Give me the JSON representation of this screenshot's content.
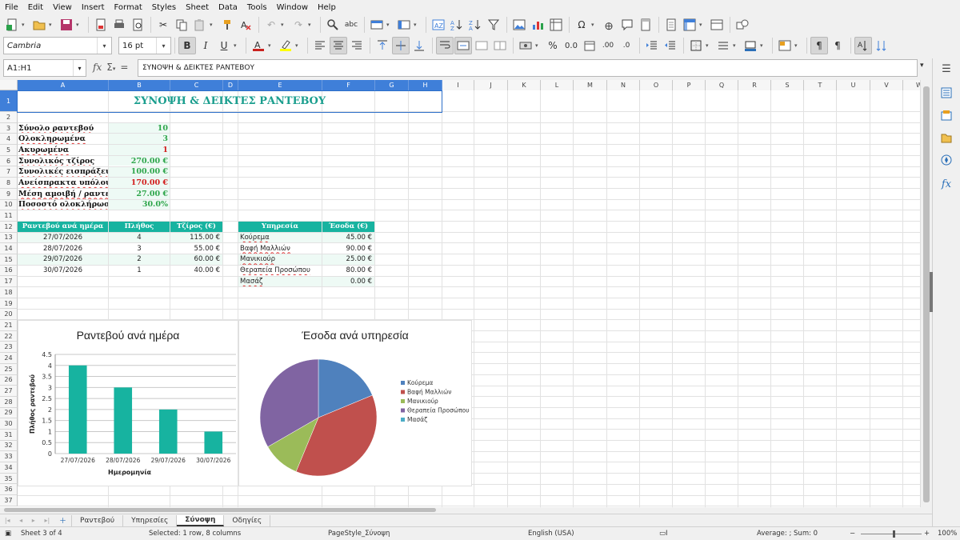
{
  "menu": [
    "File",
    "Edit",
    "View",
    "Insert",
    "Format",
    "Styles",
    "Sheet",
    "Data",
    "Tools",
    "Window",
    "Help"
  ],
  "toolbar2": {
    "font_name": "Cambria",
    "font_size": "16 pt"
  },
  "formula": {
    "name_box": "A1:H1",
    "content": "ΣΥΝΟΨΗ & ΔΕΙΚΤΕΣ ΡΑΝΤΕΒΟΥ"
  },
  "columns": [
    "A",
    "B",
    "C",
    "D",
    "E",
    "F",
    "G",
    "H",
    "I",
    "J",
    "K",
    "L",
    "M",
    "N",
    "O",
    "P",
    "Q",
    "R",
    "S",
    "T",
    "U",
    "V",
    "W"
  ],
  "rows": [
    "1",
    "2",
    "3",
    "4",
    "5",
    "6",
    "7",
    "8",
    "9",
    "10",
    "11",
    "12",
    "13",
    "14",
    "15",
    "16",
    "17",
    "18",
    "19",
    "20",
    "21",
    "22",
    "23",
    "24",
    "25",
    "26",
    "27",
    "28",
    "29",
    "30",
    "31",
    "32",
    "33",
    "34",
    "35",
    "36",
    "37"
  ],
  "sheet": {
    "title": "ΣΥΝΟΨΗ & ΔΕΙΚΤΕΣ ΡΑΝΤΕΒΟΥ",
    "kpis": [
      {
        "label": "Σύνολο ραντεβού",
        "value": "10",
        "color": "g"
      },
      {
        "label": "Ολοκληρωμένα",
        "value": "3",
        "color": "g"
      },
      {
        "label": "Ακυρωμένα",
        "value": "1",
        "color": "r"
      },
      {
        "label": "Συνολικός τζίρος",
        "value": "270.00 €",
        "color": "g"
      },
      {
        "label": "Συνολικές εισπράξεις",
        "value": "100.00 €",
        "color": "g"
      },
      {
        "label": "Ανείσπρακτα υπόλοιπα",
        "value": "170.00 €",
        "color": "r"
      },
      {
        "label": "Μέση αμοιβή / ραντεβού",
        "value": "27.00 €",
        "color": "g"
      },
      {
        "label": "Ποσοστό ολοκλήρωσης",
        "value": "30.0%",
        "color": "g"
      }
    ],
    "table1": {
      "headers": [
        "Ραντεβού ανά ημέρα",
        "Πλήθος",
        "Τζίρος (€)"
      ],
      "rows": [
        [
          "27/07/2026",
          "4",
          "115.00 €"
        ],
        [
          "28/07/2026",
          "3",
          "55.00 €"
        ],
        [
          "29/07/2026",
          "2",
          "60.00 €"
        ],
        [
          "30/07/2026",
          "1",
          "40.00 €"
        ]
      ]
    },
    "table2": {
      "headers": [
        "Υπηρεσία",
        "Έσοδα (€)"
      ],
      "rows": [
        [
          "Κούρεμα",
          "45.00 €"
        ],
        [
          "Βαφή Μαλλιών",
          "90.00 €"
        ],
        [
          "Μανικιούρ",
          "25.00 €"
        ],
        [
          "Θεραπεία Προσώπου",
          "80.00 €"
        ],
        [
          "Μασάζ",
          "0.00 €"
        ]
      ]
    }
  },
  "chart_data": [
    {
      "type": "bar",
      "title": "Ραντεβού ανά ημέρα",
      "xlabel": "Ημερομηνία",
      "ylabel": "Πλήθος ραντεβού",
      "categories": [
        "27/07/2026",
        "28/07/2026",
        "29/07/2026",
        "30/07/2026"
      ],
      "values": [
        4,
        3,
        2,
        1
      ],
      "ylim": [
        0,
        4.5
      ],
      "yticks": [
        "0",
        "0.5",
        "1",
        "1.5",
        "2",
        "2.5",
        "3",
        "3.5",
        "4",
        "4.5"
      ],
      "color": "#17b3a0",
      "grid": true
    },
    {
      "type": "pie",
      "title": "Έσοδα ανά υπηρεσία",
      "categories": [
        "Κούρεμα",
        "Βαφή Μαλλιών",
        "Μανικιούρ",
        "Θεραπεία Προσώπου",
        "Μασάζ"
      ],
      "values": [
        45,
        90,
        25,
        80,
        0
      ],
      "colors": [
        "#4f81bd",
        "#c0504d",
        "#9bbb59",
        "#8064a2",
        "#4bacc6"
      ],
      "legend": "right"
    }
  ],
  "tabs": [
    "Ραντεβού",
    "Υπηρεσίες",
    "Σύνοψη",
    "Οδηγίες"
  ],
  "active_tab": "Σύνοψη",
  "status": {
    "sheet": "Sheet 3 of 4",
    "selection": "Selected: 1 row, 8 columns",
    "page_style": "PageStyle_Σύνοψη",
    "language": "English (USA)",
    "sum": "Average: ; Sum: 0",
    "zoom": "100%"
  }
}
